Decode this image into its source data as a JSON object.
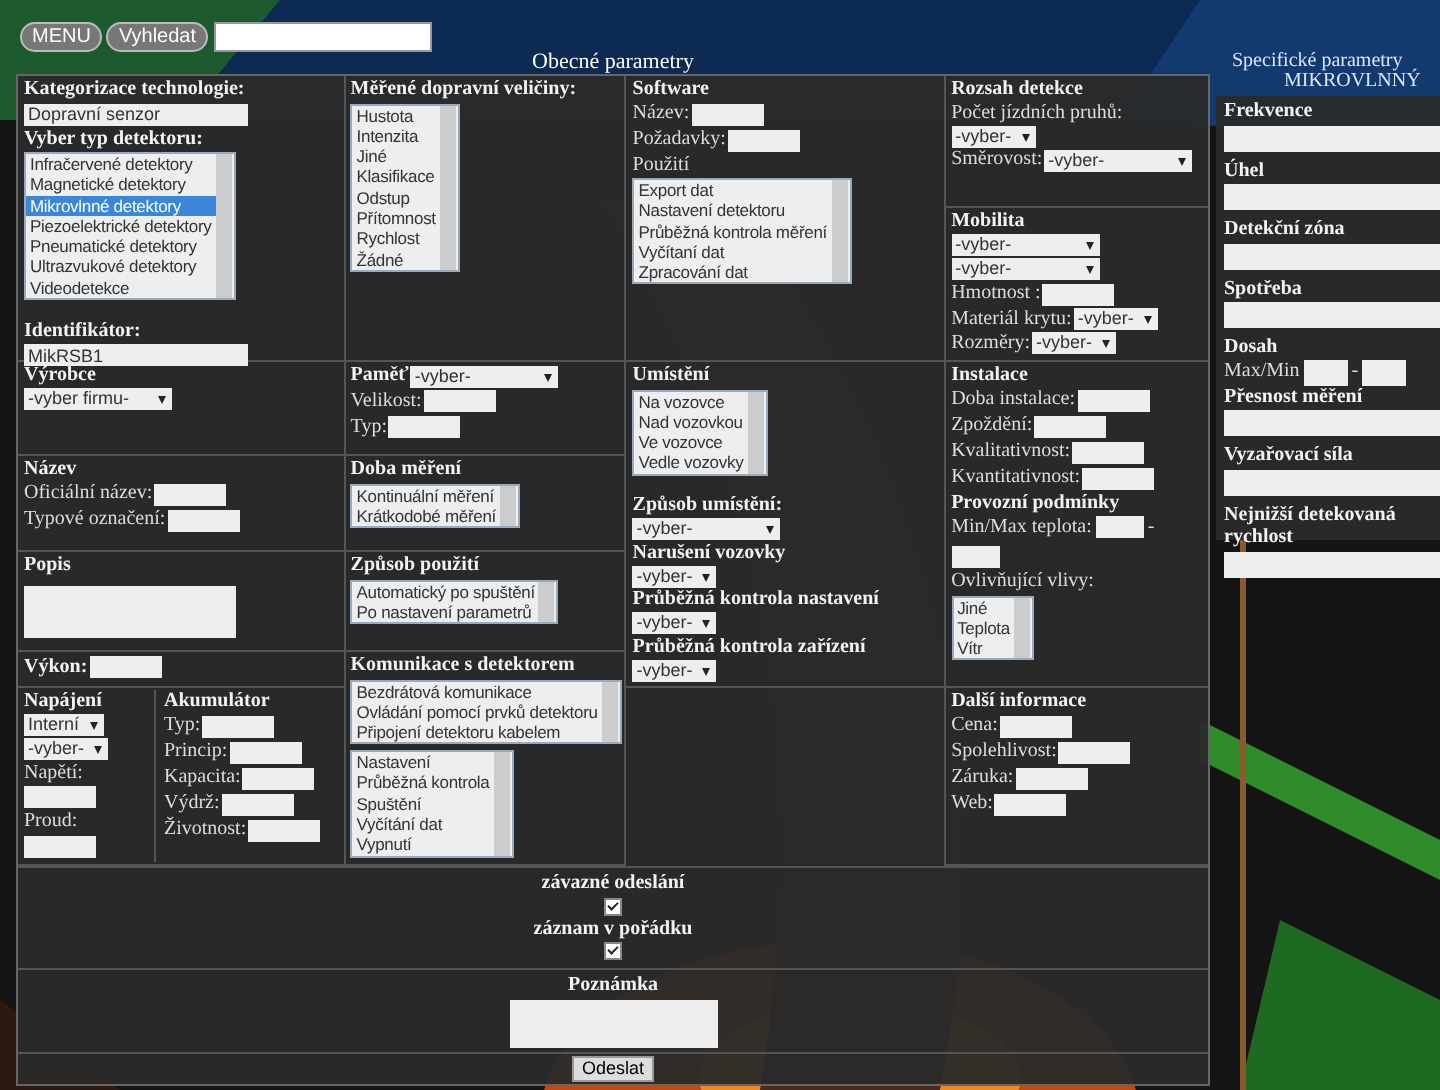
{
  "topbar": {
    "menu": "MENU",
    "search_button": "Vyhledat"
  },
  "general": {
    "title": "Obecné parametry",
    "columns": [
      [
        {
          "items": [
            {
              "kind": "heading",
              "text": "Kategorizace technologie:"
            },
            {
              "kind": "input",
              "value": "Dopravní senzor"
            },
            {
              "kind": "heading",
              "text": "Vyber typ detektoru:"
            },
            {
              "kind": "list",
              "options": [
                {
                  "text": "Infračervené detektory",
                  "selected": false
                },
                {
                  "text": "Magnetické detektory",
                  "selected": false
                },
                {
                  "text": "Mikrovlnné detektory",
                  "selected": true
                },
                {
                  "text": "Piezoelektrické detektory",
                  "selected": false
                },
                {
                  "text": "Pneumatické detektory",
                  "selected": false
                },
                {
                  "text": "Ultrazvukové detektory",
                  "selected": false
                },
                {
                  "text": "Videodetekce",
                  "selected": false
                }
              ]
            },
            {
              "kind": "heading",
              "text": "Identifikátor:"
            },
            {
              "kind": "input",
              "value": "MikRSB1"
            }
          ]
        },
        {
          "items": [
            {
              "kind": "heading",
              "text": "Výrobce"
            },
            {
              "kind": "wide-select",
              "value": "-vyber firmu-"
            }
          ]
        },
        {
          "items": [
            {
              "kind": "heading",
              "text": "Název"
            },
            {
              "kind": "field",
              "label": "Oficiální název:"
            },
            {
              "kind": "field",
              "label": "Typové označení:"
            }
          ]
        },
        {
          "items": [
            {
              "kind": "heading",
              "text": "Popis"
            },
            {
              "kind": "textarea"
            }
          ]
        },
        {
          "items": [
            {
              "kind": "heading-field",
              "label": "Výkon:"
            }
          ]
        },
        {
          "split": [
            [
              {
                "kind": "heading",
                "text": "Napájení"
              },
              {
                "kind": "select",
                "value": "Interní"
              },
              {
                "kind": "select",
                "value": "-vyber-"
              },
              {
                "kind": "label",
                "text": "Napětí:"
              },
              {
                "kind": "input"
              },
              {
                "kind": "label",
                "text": "Proud:"
              },
              {
                "kind": "input"
              }
            ],
            [
              {
                "kind": "heading",
                "text": "Akumulátor"
              },
              {
                "kind": "field",
                "label": "Typ:"
              },
              {
                "kind": "field",
                "label": "Princip:"
              },
              {
                "kind": "field",
                "label": "Kapacita:"
              },
              {
                "kind": "field",
                "label": "Výdrž:"
              },
              {
                "kind": "field",
                "label": "Životnost:"
              }
            ]
          ]
        }
      ],
      [
        {
          "items": [
            {
              "kind": "heading",
              "text": "Měřené dopravní veličiny:"
            },
            {
              "kind": "list",
              "options": [
                {
                  "text": "Hustota",
                  "selected": false
                },
                {
                  "text": "Intenzita",
                  "selected": false
                },
                {
                  "text": "Jiné",
                  "selected": false
                },
                {
                  "text": "Klasifikace",
                  "selected": false
                },
                {
                  "text": "Odstup",
                  "selected": false
                },
                {
                  "text": "Přítomnost",
                  "selected": false
                },
                {
                  "text": "Rychlost",
                  "selected": false
                },
                {
                  "text": "Žádné",
                  "selected": false
                }
              ]
            }
          ]
        },
        {
          "items": [
            {
              "kind": "heading-select",
              "label": "Paměť",
              "value": "-vyber-"
            },
            {
              "kind": "field",
              "label": "Velikost:"
            },
            {
              "kind": "field",
              "label": "Typ:"
            }
          ]
        },
        {
          "items": [
            {
              "kind": "heading",
              "text": "Doba měření"
            },
            {
              "kind": "list",
              "options": [
                {
                  "text": "Kontinuální měření",
                  "selected": false
                },
                {
                  "text": "Krátkodobé měření",
                  "selected": false
                }
              ]
            }
          ]
        },
        {
          "items": [
            {
              "kind": "heading",
              "text": "Způsob použití"
            },
            {
              "kind": "list",
              "options": [
                {
                  "text": "Automatický po spuštění",
                  "selected": false
                },
                {
                  "text": "Po nastavení parametrů",
                  "selected": false
                }
              ]
            }
          ]
        },
        {
          "items": [
            {
              "kind": "heading",
              "text": "Komunikace s detektorem"
            },
            {
              "kind": "list",
              "options": [
                {
                  "text": "Bezdrátová komunikace",
                  "selected": false
                },
                {
                  "text": "Ovládání pomocí prvků detektoru",
                  "selected": false
                },
                {
                  "text": "Připojení detektoru kabelem",
                  "selected": false
                }
              ]
            },
            {
              "kind": "list",
              "options": [
                {
                  "text": "Nastavení",
                  "selected": false
                },
                {
                  "text": "Průběžná kontrola",
                  "selected": false
                },
                {
                  "text": "Spuštění",
                  "selected": false
                },
                {
                  "text": "Vyčítání dat",
                  "selected": false
                },
                {
                  "text": "Vypnutí",
                  "selected": false
                }
              ]
            }
          ]
        }
      ],
      [
        {
          "items": [
            {
              "kind": "heading",
              "text": "Software"
            },
            {
              "kind": "field",
              "label": "Název:"
            },
            {
              "kind": "field",
              "label": "Požadavky:"
            },
            {
              "kind": "label",
              "text": "Použití"
            },
            {
              "kind": "list",
              "options": [
                {
                  "text": "Export dat",
                  "selected": false
                },
                {
                  "text": "Nastavení detektoru",
                  "selected": false
                },
                {
                  "text": "Průběžná kontrola měření",
                  "selected": false
                },
                {
                  "text": "Vyčítaní dat",
                  "selected": false
                },
                {
                  "text": "Zpracování dat",
                  "selected": false
                }
              ]
            }
          ]
        },
        {
          "items": [
            {
              "kind": "heading",
              "text": "Umístění"
            },
            {
              "kind": "list",
              "options": [
                {
                  "text": "Na vozovce",
                  "selected": false
                },
                {
                  "text": "Nad vozovkou",
                  "selected": false
                },
                {
                  "text": "Ve vozovce",
                  "selected": false
                },
                {
                  "text": "Vedle vozovky",
                  "selected": false
                }
              ]
            },
            {
              "kind": "heading",
              "text": "Způsob umístění:"
            },
            {
              "kind": "wide-select",
              "value": "-vyber-"
            },
            {
              "kind": "heading",
              "text": "Narušení vozovky"
            },
            {
              "kind": "select",
              "value": "-vyber-"
            },
            {
              "kind": "heading",
              "text": "Průběžná kontrola nastavení"
            },
            {
              "kind": "select",
              "value": "-vyber-"
            },
            {
              "kind": "heading",
              "text": "Průběžná kontrola zařízení"
            },
            {
              "kind": "select",
              "value": "-vyber-"
            }
          ]
        }
      ],
      [
        {
          "items": [
            {
              "kind": "heading",
              "text": "Rozsah detekce"
            },
            {
              "kind": "label",
              "text": "Počet jízdních pruhů:"
            },
            {
              "kind": "select",
              "value": "-vyber-"
            },
            {
              "kind": "wide-select",
              "label": "Směrovost:",
              "value": "-vyber-"
            }
          ]
        },
        {
          "items": [
            {
              "kind": "heading",
              "text": "Mobilita"
            },
            {
              "kind": "wide-select",
              "value": "-vyber-"
            },
            {
              "kind": "wide-select",
              "value": "-vyber-"
            },
            {
              "kind": "field",
              "label": "Hmotnost :"
            },
            {
              "kind": "select",
              "label": "Materiál krytu:",
              "value": "-vyber-"
            },
            {
              "kind": "select",
              "label": "Rozměry:",
              "value": "-vyber-"
            }
          ]
        },
        {
          "items": [
            {
              "kind": "heading",
              "text": "Instalace"
            },
            {
              "kind": "field",
              "label": "Doba instalace:"
            },
            {
              "kind": "field",
              "label": "Zpoždění:"
            },
            {
              "kind": "field",
              "label": "Kvalitativnost:"
            },
            {
              "kind": "field",
              "label": "Kvantitativnost:"
            },
            {
              "kind": "heading",
              "text": "Provozní podmínky"
            },
            {
              "kind": "range",
              "label": "Min/Max teplota:",
              "separator": "-"
            },
            {
              "kind": "label",
              "text": "Ovlivňující vlivy:"
            },
            {
              "kind": "list",
              "options": [
                {
                  "text": "Jiné",
                  "selected": false
                },
                {
                  "text": "Teplota",
                  "selected": false
                },
                {
                  "text": "Vítr",
                  "selected": false
                }
              ]
            }
          ]
        },
        {
          "items": [
            {
              "kind": "heading",
              "text": "Další informace"
            },
            {
              "kind": "field",
              "label": "Cena:"
            },
            {
              "kind": "field",
              "label": "Spolehlivost:"
            },
            {
              "kind": "field",
              "label": "Záruka:"
            },
            {
              "kind": "field",
              "label": "Web:"
            }
          ]
        }
      ]
    ],
    "confirmations": [
      {
        "label": "závazné odeslání",
        "checked": true
      },
      {
        "label": "záznam v pořádku",
        "checked": true
      }
    ],
    "note": {
      "label": "Poznámka"
    },
    "submit": "Odeslat"
  },
  "specific": {
    "title": "Specifické parametry",
    "subtitle": "MIKROVLNNÝ",
    "items": [
      {
        "kind": "heading",
        "text": "Frekvence"
      },
      {
        "kind": "input"
      },
      {
        "kind": "heading",
        "text": "Úhel"
      },
      {
        "kind": "input"
      },
      {
        "kind": "heading",
        "text": "Detekční zóna"
      },
      {
        "kind": "input"
      },
      {
        "kind": "heading",
        "text": "Spotřeba"
      },
      {
        "kind": "input"
      },
      {
        "kind": "heading",
        "text": "Dosah"
      },
      {
        "kind": "range",
        "label": "Max/Min",
        "separator": "-"
      },
      {
        "kind": "heading",
        "text": "Přesnost měření"
      },
      {
        "kind": "input"
      },
      {
        "kind": "heading",
        "text": "Vyzařovací síla"
      },
      {
        "kind": "input"
      },
      {
        "kind": "heading",
        "text": "Nejnižší detekovaná rychlost"
      },
      {
        "kind": "input"
      }
    ]
  }
}
